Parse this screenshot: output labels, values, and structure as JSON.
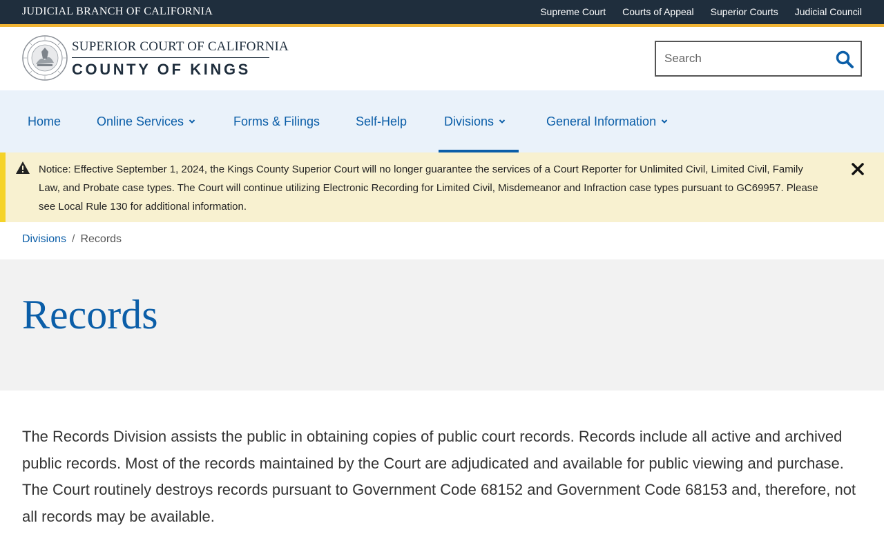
{
  "topbar": {
    "branch_title": "JUDICIAL BRANCH OF CALIFORNIA",
    "links": [
      "Supreme Court",
      "Courts of Appeal",
      "Superior Courts",
      "Judicial Council"
    ]
  },
  "header": {
    "logo_line1": "SUPERIOR COURT OF CALIFORNIA",
    "logo_line2": "COUNTY OF KINGS",
    "seal_icon": "court-seal",
    "search": {
      "placeholder": "Search",
      "value": ""
    }
  },
  "nav": {
    "items": [
      {
        "label": "Home",
        "dropdown": false
      },
      {
        "label": "Online Services",
        "dropdown": true
      },
      {
        "label": "Forms & Filings",
        "dropdown": false
      },
      {
        "label": "Self-Help",
        "dropdown": false
      },
      {
        "label": "Divisions",
        "dropdown": true,
        "active": true
      },
      {
        "label": "General Information",
        "dropdown": true
      }
    ]
  },
  "notice": {
    "text": "Notice: Effective September 1, 2024, the Kings County Superior Court will no longer guarantee the services of a Court Reporter for Unlimited Civil, Limited Civil, Family Law, and Probate case types. The Court will continue utilizing Electronic Recording for Limited Civil, Misdemeanor and Infraction case types pursuant to GC69957. Please see Local Rule 130 for additional information."
  },
  "breadcrumb": {
    "parent": "Divisions",
    "separator": "/",
    "current": "Records"
  },
  "page": {
    "title": "Records",
    "intro": "The Records Division assists the public in obtaining copies of public court records. Records include all active and archived public records. Most of the records maintained by the Court are adjudicated and available for public viewing and purchase. The Court routinely destroys records pursuant to Government Code 68152 and Government Code 68153 and, therefore, not all records may be available."
  },
  "colors": {
    "topbar": "#1f2e3d",
    "accent_gold": "#f1b434",
    "link_blue": "#0b5ea8",
    "nav_bg": "#eaf2fa",
    "notice_bg": "#f8f1d0",
    "notice_stripe": "#f5d328",
    "title_band": "#f2f2f2"
  }
}
